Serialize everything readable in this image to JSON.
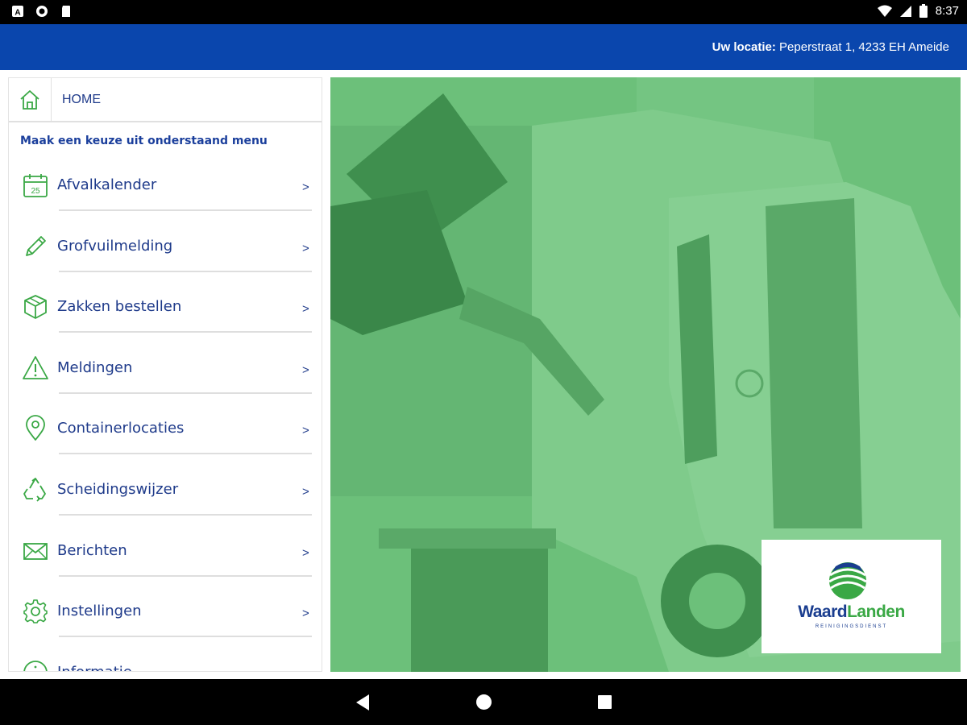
{
  "status_bar": {
    "time": "8:37",
    "left_icons": [
      "notification-a-icon",
      "sync-icon",
      "sd-card-icon"
    ],
    "right_icons": [
      "wifi-icon",
      "signal-icon",
      "battery-icon"
    ]
  },
  "header": {
    "location_label": "Uw locatie:",
    "location_value": "Peperstraat 1, 4233 EH Ameide",
    "bg_color": "#0a46ad"
  },
  "menu": {
    "home_label": "HOME",
    "intro": "Maak een keuze uit onderstaand menu",
    "items": [
      {
        "label": "Afvalkalender",
        "icon": "calendar-icon",
        "arrow": ">"
      },
      {
        "label": "Grofvuilmelding",
        "icon": "pencil-icon",
        "arrow": ">"
      },
      {
        "label": "Zakken bestellen",
        "icon": "box-icon",
        "arrow": ">"
      },
      {
        "label": "Meldingen",
        "icon": "warning-icon",
        "arrow": ">"
      },
      {
        "label": "Containerlocaties",
        "icon": "map-pin-icon",
        "arrow": ">"
      },
      {
        "label": "Scheidingswijzer",
        "icon": "recycle-icon",
        "arrow": ">"
      },
      {
        "label": "Berichten",
        "icon": "envelope-icon",
        "arrow": ">"
      },
      {
        "label": "Instellingen",
        "icon": "gear-icon",
        "arrow": ">"
      },
      {
        "label": "Informatie",
        "icon": "info-icon",
        "arrow": ">"
      }
    ],
    "icon_color": "#3aa845",
    "text_color": "#1e3a8a"
  },
  "hero": {
    "overlay_color": "#6cc07a",
    "logo_name_part1": "Waard",
    "logo_name_part2": "Landen",
    "logo_subtitle": "REINIGINGSDIENST"
  }
}
